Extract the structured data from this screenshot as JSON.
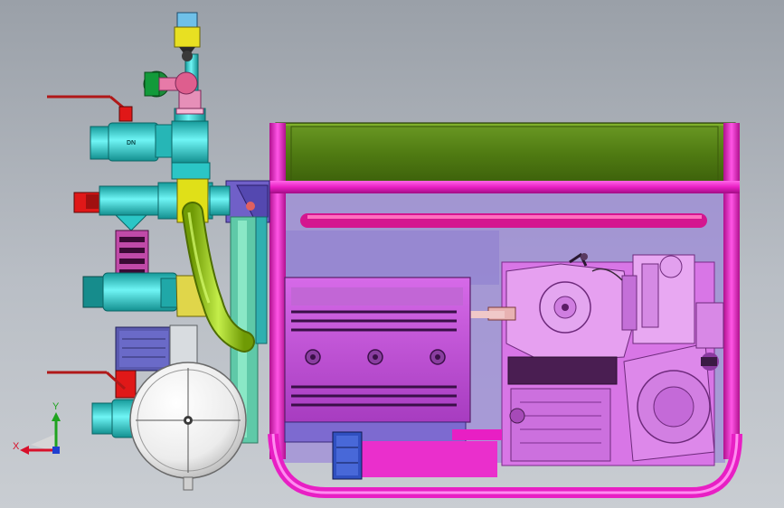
{
  "viewport": {
    "background": [
      "#9aa0a8",
      "#c9cdd2"
    ],
    "triad": {
      "x_label": "X",
      "y_label": "Y",
      "x_color": "#d8102a",
      "y_color": "#1fa31f",
      "z_color": "#2040d0"
    }
  },
  "model": {
    "valve_marking": "DN",
    "colors": {
      "frame": "#e81fc4",
      "tank": "#4f7a12",
      "pipe_cyan": "#2fd9d9",
      "hose": "#9acb10",
      "engine": "#d873e8",
      "pump_box": "#c35bd6",
      "gauge": "#f2f2f2",
      "handle": "#c22020"
    }
  }
}
